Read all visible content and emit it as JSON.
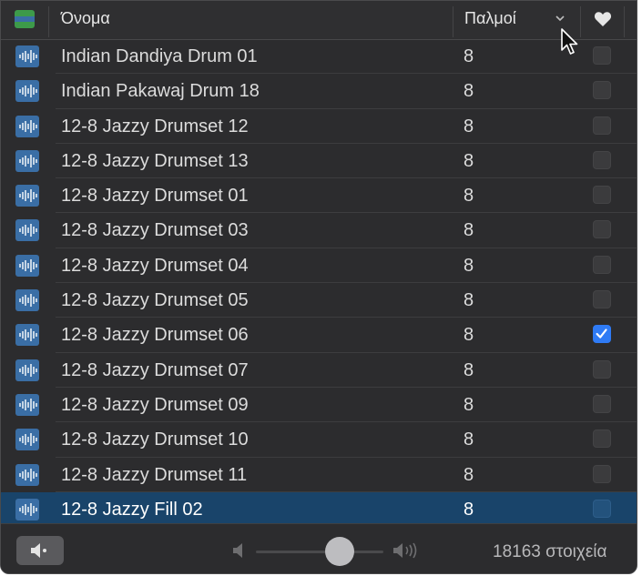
{
  "header": {
    "name_label": "Όνομα",
    "beats_label": "Παλμοί",
    "type_icon": "loop-type-color-icon",
    "sort_icon": "chevron-down-icon",
    "favorite_icon": "heart-icon"
  },
  "rows": [
    {
      "name": "Indian Dandiya Drum 01",
      "beats": "8",
      "favorite": false
    },
    {
      "name": "Indian Pakawaj Drum 18",
      "beats": "8",
      "favorite": false
    },
    {
      "name": "12-8 Jazzy Drumset 12",
      "beats": "8",
      "favorite": false
    },
    {
      "name": "12-8 Jazzy Drumset 13",
      "beats": "8",
      "favorite": false
    },
    {
      "name": "12-8 Jazzy Drumset 01",
      "beats": "8",
      "favorite": false
    },
    {
      "name": "12-8 Jazzy Drumset 03",
      "beats": "8",
      "favorite": false
    },
    {
      "name": "12-8 Jazzy Drumset 04",
      "beats": "8",
      "favorite": false
    },
    {
      "name": "12-8 Jazzy Drumset 05",
      "beats": "8",
      "favorite": false
    },
    {
      "name": "12-8 Jazzy Drumset 06",
      "beats": "8",
      "favorite": true
    },
    {
      "name": "12-8 Jazzy Drumset 07",
      "beats": "8",
      "favorite": false
    },
    {
      "name": "12-8 Jazzy Drumset 09",
      "beats": "8",
      "favorite": false
    },
    {
      "name": "12-8 Jazzy Drumset 10",
      "beats": "8",
      "favorite": false
    },
    {
      "name": "12-8 Jazzy Drumset 11",
      "beats": "8",
      "favorite": false
    },
    {
      "name": "12-8 Jazzy Fill 02",
      "beats": "8",
      "favorite": false,
      "selected": true
    }
  ],
  "footer": {
    "count_text": "18163 στοιχεία",
    "volume_level": 0.66,
    "speaker_button_icon": "speaker-icon",
    "volume_low_icon": "speaker-low-icon",
    "volume_high_icon": "speaker-high-icon"
  },
  "colors": {
    "selection": "#19446a",
    "waveform_icon_bg": "#3a6ea5",
    "checkbox_on": "#2f7bf5",
    "type_icon_bands": [
      "#3d9a4a",
      "#3a6ea5",
      "#3d9a4a"
    ]
  }
}
